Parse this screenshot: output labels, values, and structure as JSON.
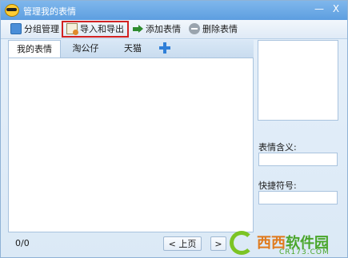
{
  "window": {
    "title": "管理我的表情",
    "minimize": "—",
    "close": "X"
  },
  "toolbar": {
    "group": "分组管理",
    "import_export": "导入和导出",
    "add": "添加表情",
    "delete": "删除表情"
  },
  "tabs": [
    "我的表情",
    "淘公仔",
    "天猫"
  ],
  "footer": {
    "page_count": "0/0",
    "prev": "< 上页",
    "next": ">"
  },
  "side": {
    "meaning_label": "表情含义:",
    "meaning_value": "",
    "shortcut_label": "快捷符号:",
    "shortcut_value": ""
  },
  "watermark": {
    "brand_a": "西西",
    "brand_b": "软件园",
    "domain": "CR173.COM"
  },
  "colors": {
    "titlebar": "#6aa9e6",
    "highlight": "#d22222"
  }
}
